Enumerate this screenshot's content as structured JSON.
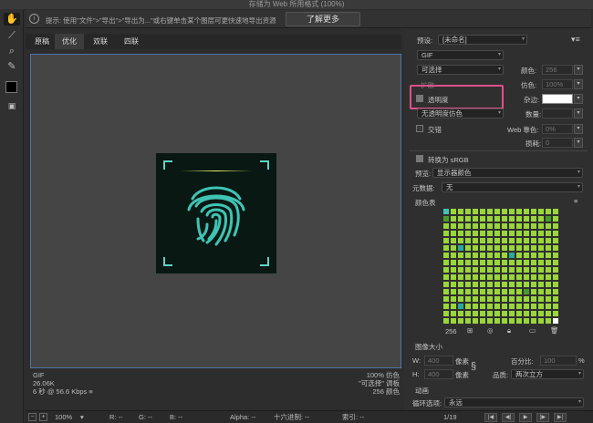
{
  "window": {
    "title": "存储为 Web 所用格式 (100%)"
  },
  "hint": {
    "text": "提示: 使用\"文件\">\"导出\">\"导出为...\"或右键单击某个图层可更快速地导出资源",
    "button": "了解更多"
  },
  "tools": [
    {
      "name": "hand-tool-icon",
      "glyph": "✋"
    },
    {
      "name": "slice-select-tool-icon",
      "glyph": "⟋"
    },
    {
      "name": "zoom-tool-icon",
      "glyph": "⌕"
    },
    {
      "name": "eyedropper-tool-icon",
      "glyph": "✎"
    }
  ],
  "tabs": [
    "原稿",
    "优化",
    "双联",
    "四联"
  ],
  "canvas_info": {
    "format": "GIF",
    "size": "26.06K",
    "time": "6 秒 @ 56.6 Kbps",
    "menu": "≡",
    "dither": "100% 仿色",
    "palette": "\"可选择\" 调板",
    "colors": "256 颜色"
  },
  "panel": {
    "preset_label": "预设:",
    "preset_value": "[未命名]",
    "format_value": "GIF",
    "reduction_value": "可选择",
    "colors_label": "颜色:",
    "colors_value": "256",
    "dither_algo_value": "扩散",
    "dither_label": "仿色:",
    "dither_value": "100%",
    "transparency_label": "透明度",
    "matte_label": "杂边:",
    "trans_dither_value": "无透明度仿色",
    "amount_label": "数量:",
    "interlaced_label": "交错",
    "web_snap_label": "Web 靠色:",
    "web_snap_value": "0%",
    "lossy_label": "损耗:",
    "lossy_value": "0",
    "srgb_label": "转换为 sRGB",
    "preview_label": "预览:",
    "preview_value": "显示器颜色",
    "metadata_label": "元数据:",
    "metadata_value": "无",
    "color_table_label": "颜色表",
    "color_count": "256",
    "image_size_label": "图像大小",
    "w_label": "W:",
    "w_value": "400",
    "h_label": "H:",
    "h_value": "400",
    "px_unit": "像素",
    "percent_label": "百分比:",
    "percent_value": "100",
    "percent_unit": "%",
    "quality_label": "品质:",
    "quality_value": "两次立方",
    "animation_label": "动画",
    "loop_label": "循环选项:",
    "loop_value": "永远",
    "frame_counter": "1/19"
  },
  "bottom": {
    "zoom": "100%",
    "r": "R: --",
    "g": "G: --",
    "b": "B: --",
    "alpha": "Alpha: --",
    "hex": "十六进制: --",
    "index": "索引: --"
  },
  "colors": {
    "accent_highlight": "#e0508a",
    "artwork_bg": "#0a1814",
    "fingerprint": "#3fc4b4"
  }
}
